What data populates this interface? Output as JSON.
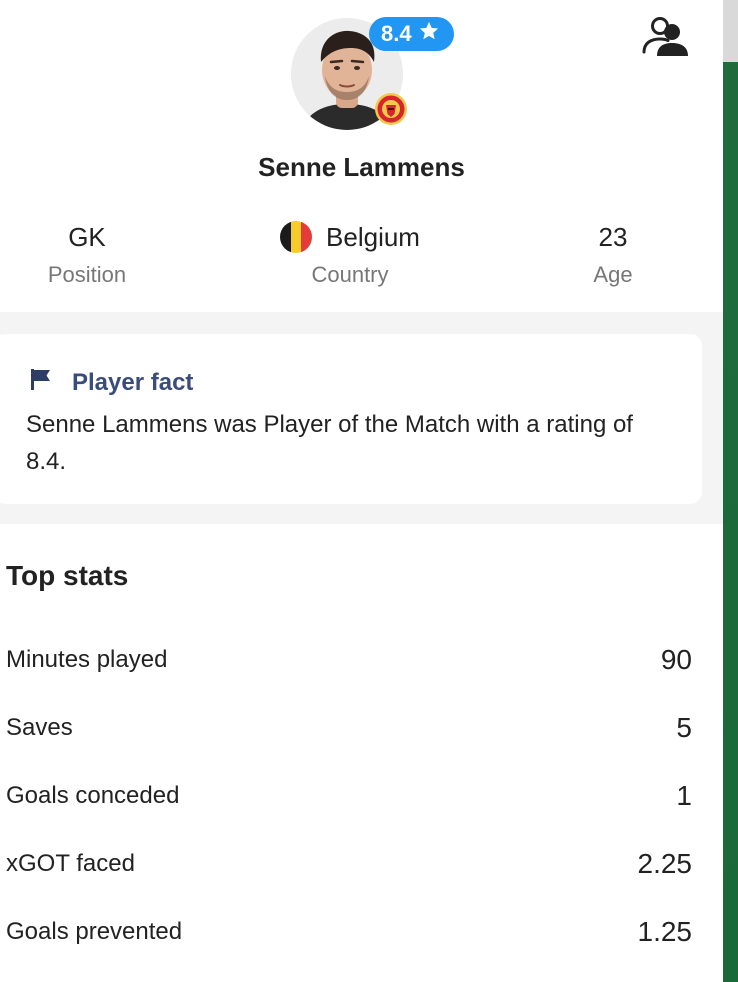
{
  "player": {
    "name": "Senne Lammens",
    "rating": "8.4",
    "position_value": "GK",
    "position_label": "Position",
    "country_value": "Belgium",
    "country_label": "Country",
    "age_value": "23",
    "age_label": "Age"
  },
  "icons": {
    "rating": "star-icon",
    "profile": "user-switch-icon",
    "fact": "flag-icon",
    "club": "club-crest-icon",
    "country": "belgium-flag-icon"
  },
  "colors": {
    "rating_badge": "#2196f3",
    "fact_title": "#3a4d7a",
    "section_bg": "#f4f4f4",
    "flag_black": "#1b1b1b",
    "flag_yellow": "#f5cc2a",
    "flag_red": "#e63b3b"
  },
  "fact": {
    "title": "Player fact",
    "text": "Senne Lammens was Player of the Match with a rating of 8.4."
  },
  "stats": {
    "title": "Top stats",
    "rows": [
      {
        "label": "Minutes played",
        "value": "90"
      },
      {
        "label": "Saves",
        "value": "5"
      },
      {
        "label": "Goals conceded",
        "value": "1"
      },
      {
        "label": "xGOT faced",
        "value": "2.25"
      },
      {
        "label": "Goals prevented",
        "value": "1.25"
      }
    ]
  }
}
